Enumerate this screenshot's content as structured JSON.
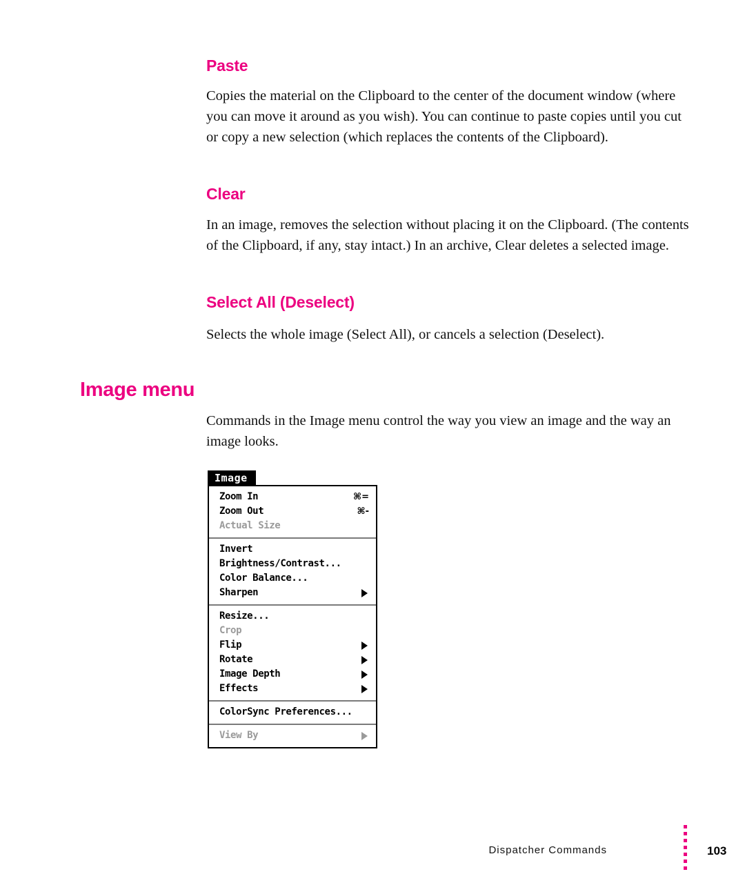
{
  "sections": [
    {
      "heading": "Paste",
      "body": "Copies the material on the Clipboard to the center of the document window (where you can move it around as you wish). You can continue to paste copies until you cut or copy a new selection (which replaces the contents of the Clipboard)."
    },
    {
      "heading": "Clear",
      "body": "In an image, removes the selection without placing it on the Clipboard. (The contents of the Clipboard, if any, stay intact.) In an archive, Clear deletes a selected image."
    },
    {
      "heading": "Select All (Deselect)",
      "body": "Selects the whole image (Select All), or cancels a selection (Deselect)."
    }
  ],
  "chapter": {
    "heading": "Image menu",
    "body": "Commands in the Image menu control the way you view an image and the way an image looks."
  },
  "menu": {
    "title": "Image",
    "groups": [
      {
        "items": [
          {
            "label": "Zoom In",
            "shortcut": "⌘=",
            "disabled": false,
            "submenu": false
          },
          {
            "label": "Zoom Out",
            "shortcut": "⌘-",
            "disabled": false,
            "submenu": false
          },
          {
            "label": "Actual Size",
            "shortcut": "",
            "disabled": true,
            "submenu": false
          }
        ]
      },
      {
        "items": [
          {
            "label": "Invert",
            "shortcut": "",
            "disabled": false,
            "submenu": false
          },
          {
            "label": "Brightness/Contrast...",
            "shortcut": "",
            "disabled": false,
            "submenu": false
          },
          {
            "label": "Color Balance...",
            "shortcut": "",
            "disabled": false,
            "submenu": false
          },
          {
            "label": "Sharpen",
            "shortcut": "",
            "disabled": false,
            "submenu": true
          }
        ]
      },
      {
        "items": [
          {
            "label": "Resize...",
            "shortcut": "",
            "disabled": false,
            "submenu": false
          },
          {
            "label": "Crop",
            "shortcut": "",
            "disabled": true,
            "submenu": false
          },
          {
            "label": "Flip",
            "shortcut": "",
            "disabled": false,
            "submenu": true
          },
          {
            "label": "Rotate",
            "shortcut": "",
            "disabled": false,
            "submenu": true
          },
          {
            "label": "Image Depth",
            "shortcut": "",
            "disabled": false,
            "submenu": true
          },
          {
            "label": "Effects",
            "shortcut": "",
            "disabled": false,
            "submenu": true
          }
        ]
      },
      {
        "items": [
          {
            "label": "ColorSync Preferences...",
            "shortcut": "",
            "disabled": false,
            "submenu": false
          }
        ]
      },
      {
        "items": [
          {
            "label": "View By",
            "shortcut": "",
            "disabled": true,
            "submenu": true
          }
        ]
      }
    ]
  },
  "footer": {
    "label": "Dispatcher Commands",
    "page": "103",
    "dot_count": 7
  },
  "colors": {
    "accent": "#ec0080",
    "text": "#111111",
    "menu_disabled": "#9a9a9a"
  }
}
